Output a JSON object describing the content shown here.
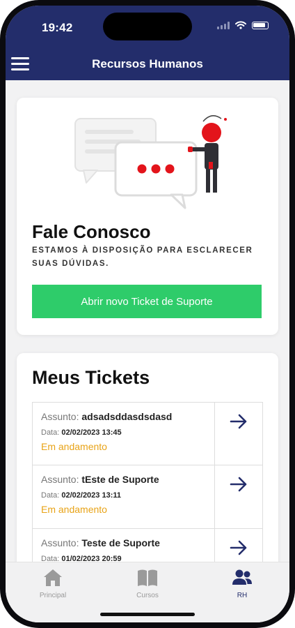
{
  "status_bar": {
    "time": "19:42"
  },
  "header": {
    "title": "Recursos Humanos"
  },
  "contact": {
    "title": "Fale Conosco",
    "subtitle": "ESTAMOS À DISPOSIÇÃO PARA ESCLARECER SUAS DÚVIDAS.",
    "button_label": "Abrir novo Ticket de Suporte"
  },
  "tickets": {
    "title": "Meus Tickets",
    "subject_label": "Assunto:",
    "date_label": "Data:",
    "items": [
      {
        "subject": "adsadsddasdsdasd",
        "date": "02/02/2023 13:45",
        "status": "Em andamento"
      },
      {
        "subject": "tEste de Suporte",
        "date": "02/02/2023 13:11",
        "status": "Em andamento"
      },
      {
        "subject": "Teste de Suporte",
        "date": "01/02/2023 20:59",
        "status": ""
      }
    ]
  },
  "tabbar": {
    "items": [
      {
        "label": "Principal",
        "icon": "home-icon"
      },
      {
        "label": "Cursos",
        "icon": "book-icon"
      },
      {
        "label": "RH",
        "icon": "users-icon"
      }
    ],
    "active": "RH"
  },
  "colors": {
    "header": "#232d6b",
    "button": "#2ecc6a",
    "status": "#e8a317",
    "accent_red": "#e3141b"
  }
}
